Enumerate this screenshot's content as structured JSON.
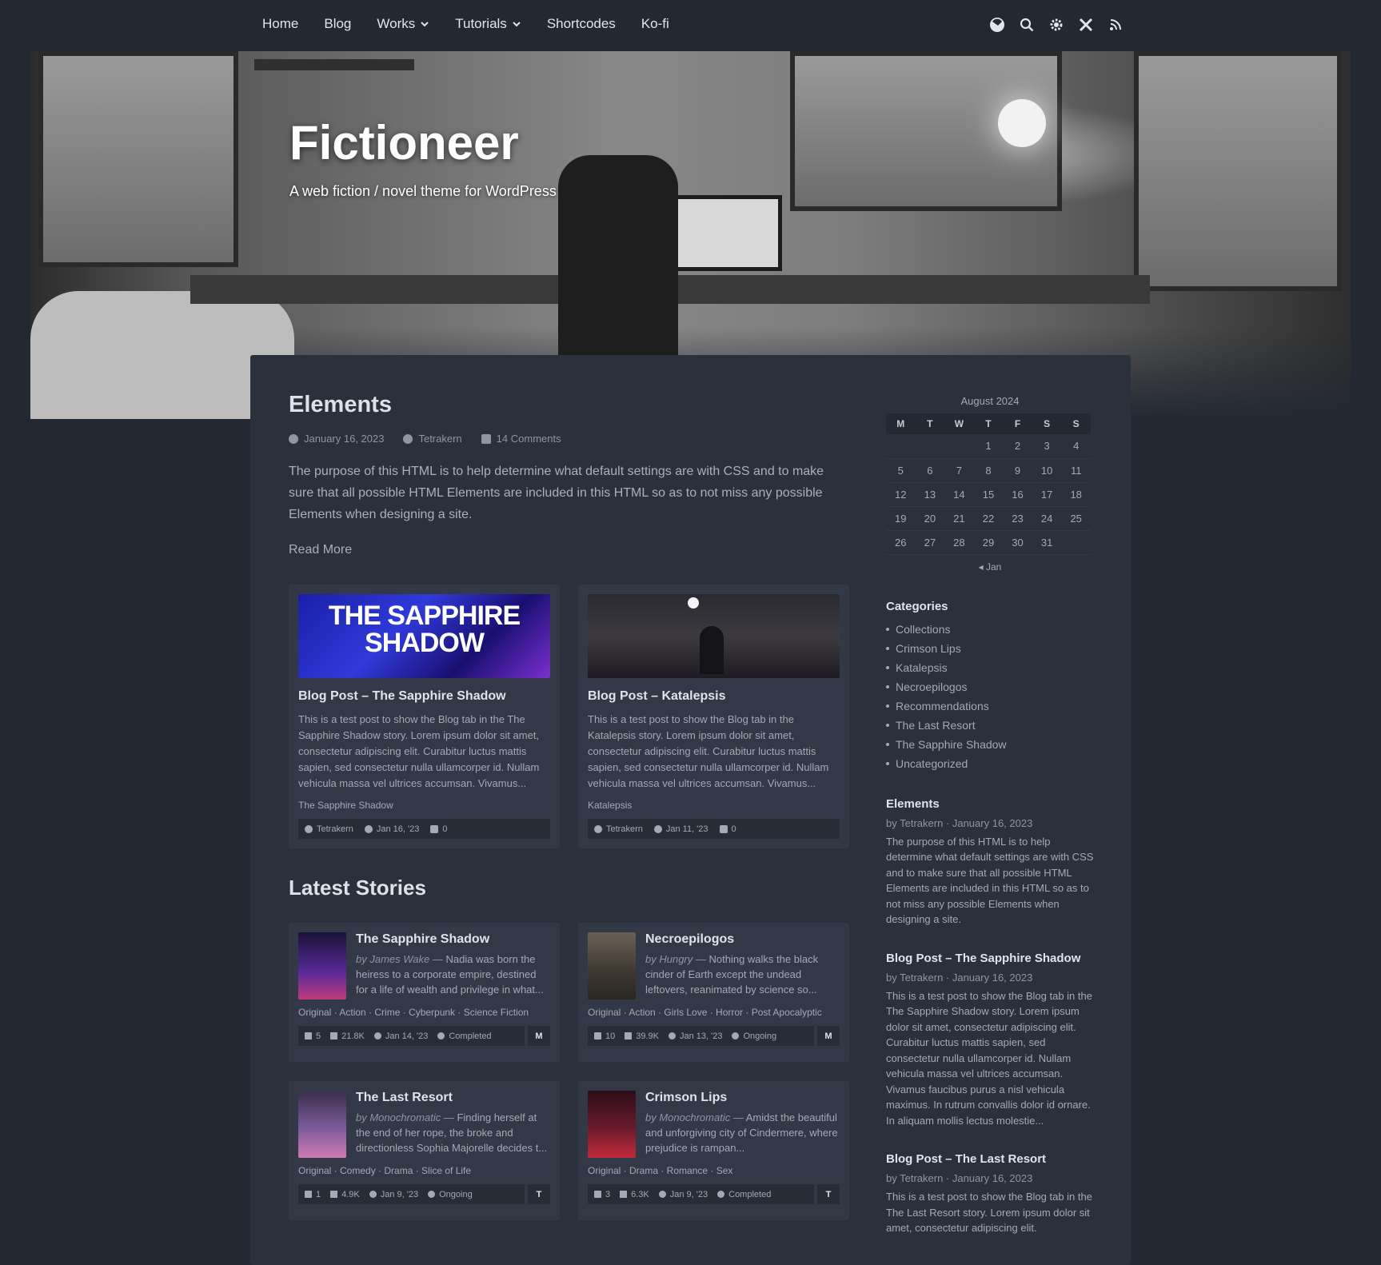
{
  "nav": {
    "items": [
      {
        "label": "Home"
      },
      {
        "label": "Blog"
      },
      {
        "label": "Works"
      },
      {
        "label": "Tutorials"
      },
      {
        "label": "Shortcodes"
      },
      {
        "label": "Ko-fi"
      }
    ]
  },
  "header": {
    "title": "Fictioneer",
    "subtitle": "A web fiction / novel theme for WordPress"
  },
  "post": {
    "title": "Elements",
    "date": "January 16, 2023",
    "author": "Tetrakern",
    "comments": "14 Comments",
    "excerpt": "The purpose of this HTML is to help determine what default settings are with CSS and to make sure that all possible HTML Elements are included in this HTML so as to not miss any possible Elements when designing a site.",
    "read_more": "Read More"
  },
  "blog_cards": [
    {
      "img_text": "THE SAPPHIRE SHADOW",
      "title": "Blog Post – The Sapphire Shadow",
      "text": "This is a test post to show the Blog tab in the The Sapphire Shadow story. Lorem ipsum dolor sit amet, consectetur adipiscing elit. Curabitur luctus mattis sapien, sed consectetur nulla ullamcorper id. Nullam vehicula massa vel ultrices accumsan. Vivamus...",
      "tag": "The Sapphire Shadow",
      "author": "Tetrakern",
      "date": "Jan 16, '23",
      "comments": "0"
    },
    {
      "title": "Blog Post – Katalepsis",
      "text": "This is a test post to show the Blog tab in the Katalepsis story. Lorem ipsum dolor sit amet, consectetur adipiscing elit. Curabitur luctus mattis sapien, sed consectetur nulla ullamcorper id. Nullam vehicula massa vel ultrices accumsan. Vivamus...",
      "tag": "Katalepsis",
      "author": "Tetrakern",
      "date": "Jan 11, '23",
      "comments": "0"
    }
  ],
  "latest": {
    "title": "Latest Stories",
    "stories": [
      {
        "title": "The Sapphire Shadow",
        "by": "by James Wake —",
        "desc": "Nadia was born the heiress to a corporate empire, destined for a life of wealth and privilege in what...",
        "tags": "Original · Action · Crime · Cyberpunk · Science Fiction",
        "chapters": "5",
        "words": "21.8K",
        "date": "Jan 14, '23",
        "status": "Completed",
        "rating": "M",
        "cover_color": "#3a1f6e"
      },
      {
        "title": "Necroepilogos",
        "by": "by Hungry —",
        "desc": "Nothing walks the black cinder of Earth except the undead leftovers, reanimated by science so...",
        "tags": "Original · Action · Girls Love · Horror · Post Apocalyptic",
        "chapters": "10",
        "words": "39.9K",
        "date": "Jan 13, '23",
        "status": "Ongoing",
        "rating": "M",
        "cover_color": "#4a4540"
      },
      {
        "title": "The Last Resort",
        "by": "by Monochromatic —",
        "desc": "Finding herself at the end of her rope, the broke and directionless Sophia Majorelle decides t...",
        "tags": "Original · Comedy · Drama · Slice of Life",
        "chapters": "1",
        "words": "4.9K",
        "date": "Jan 9, '23",
        "status": "Ongoing",
        "rating": "T",
        "cover_color": "#5b4a7a"
      },
      {
        "title": "Crimson Lips",
        "by": "by Monochromatic —",
        "desc": "Amidst the beautiful and unforgiving city of Cindermere, where prejudice is rampan...",
        "tags": "Original · Drama · Romance · Sex",
        "chapters": "3",
        "words": "6.3K",
        "date": "Jan 9, '23",
        "status": "Completed",
        "rating": "T",
        "cover_color": "#5a1a2a"
      }
    ]
  },
  "calendar": {
    "caption": "August 2024",
    "days": [
      "M",
      "T",
      "W",
      "T",
      "F",
      "S",
      "S"
    ],
    "weeks": [
      [
        "",
        "",
        "",
        "1",
        "2",
        "3",
        "4"
      ],
      [
        "5",
        "6",
        "7",
        "8",
        "9",
        "10",
        "11"
      ],
      [
        "12",
        "13",
        "14",
        "15",
        "16",
        "17",
        "18"
      ],
      [
        "19",
        "20",
        "21",
        "22",
        "23",
        "24",
        "25"
      ],
      [
        "26",
        "27",
        "28",
        "29",
        "30",
        "31",
        ""
      ]
    ],
    "prev": "◂ Jan"
  },
  "categories": {
    "title": "Categories",
    "items": [
      "Collections",
      "Crimson Lips",
      "Katalepsis",
      "Necroepilogos",
      "Recommendations",
      "The Last Resort",
      "The Sapphire Shadow",
      "Uncategorized"
    ]
  },
  "recent": [
    {
      "title": "Elements",
      "meta": "by Tetrakern · January 16, 2023",
      "text": "The purpose of this HTML is to help determine what default settings are with CSS and to make sure that all possible HTML Elements are included in this HTML so as to not miss any possible Elements when designing a site."
    },
    {
      "title": "Blog Post – The Sapphire Shadow",
      "meta": "by Tetrakern · January 16, 2023",
      "text": "This is a test post to show the Blog tab in the The Sapphire Shadow story. Lorem ipsum dolor sit amet, consectetur adipiscing elit. Curabitur luctus mattis sapien, sed consectetur nulla ullamcorper id. Nullam vehicula massa vel ultrices accumsan. Vivamus faucibus purus a nisl vehicula maximus. In rutrum convallis dolor id ornare. In aliquam mollis lectus molestie..."
    },
    {
      "title": "Blog Post – The Last Resort",
      "meta": "by Tetrakern · January 16, 2023",
      "text": "This is a test post to show the Blog tab in the The Last Resort story. Lorem ipsum dolor sit amet, consectetur adipiscing elit."
    }
  ],
  "colors": {
    "bg": "#232833",
    "panel": "#2b303d",
    "card": "#323846"
  }
}
